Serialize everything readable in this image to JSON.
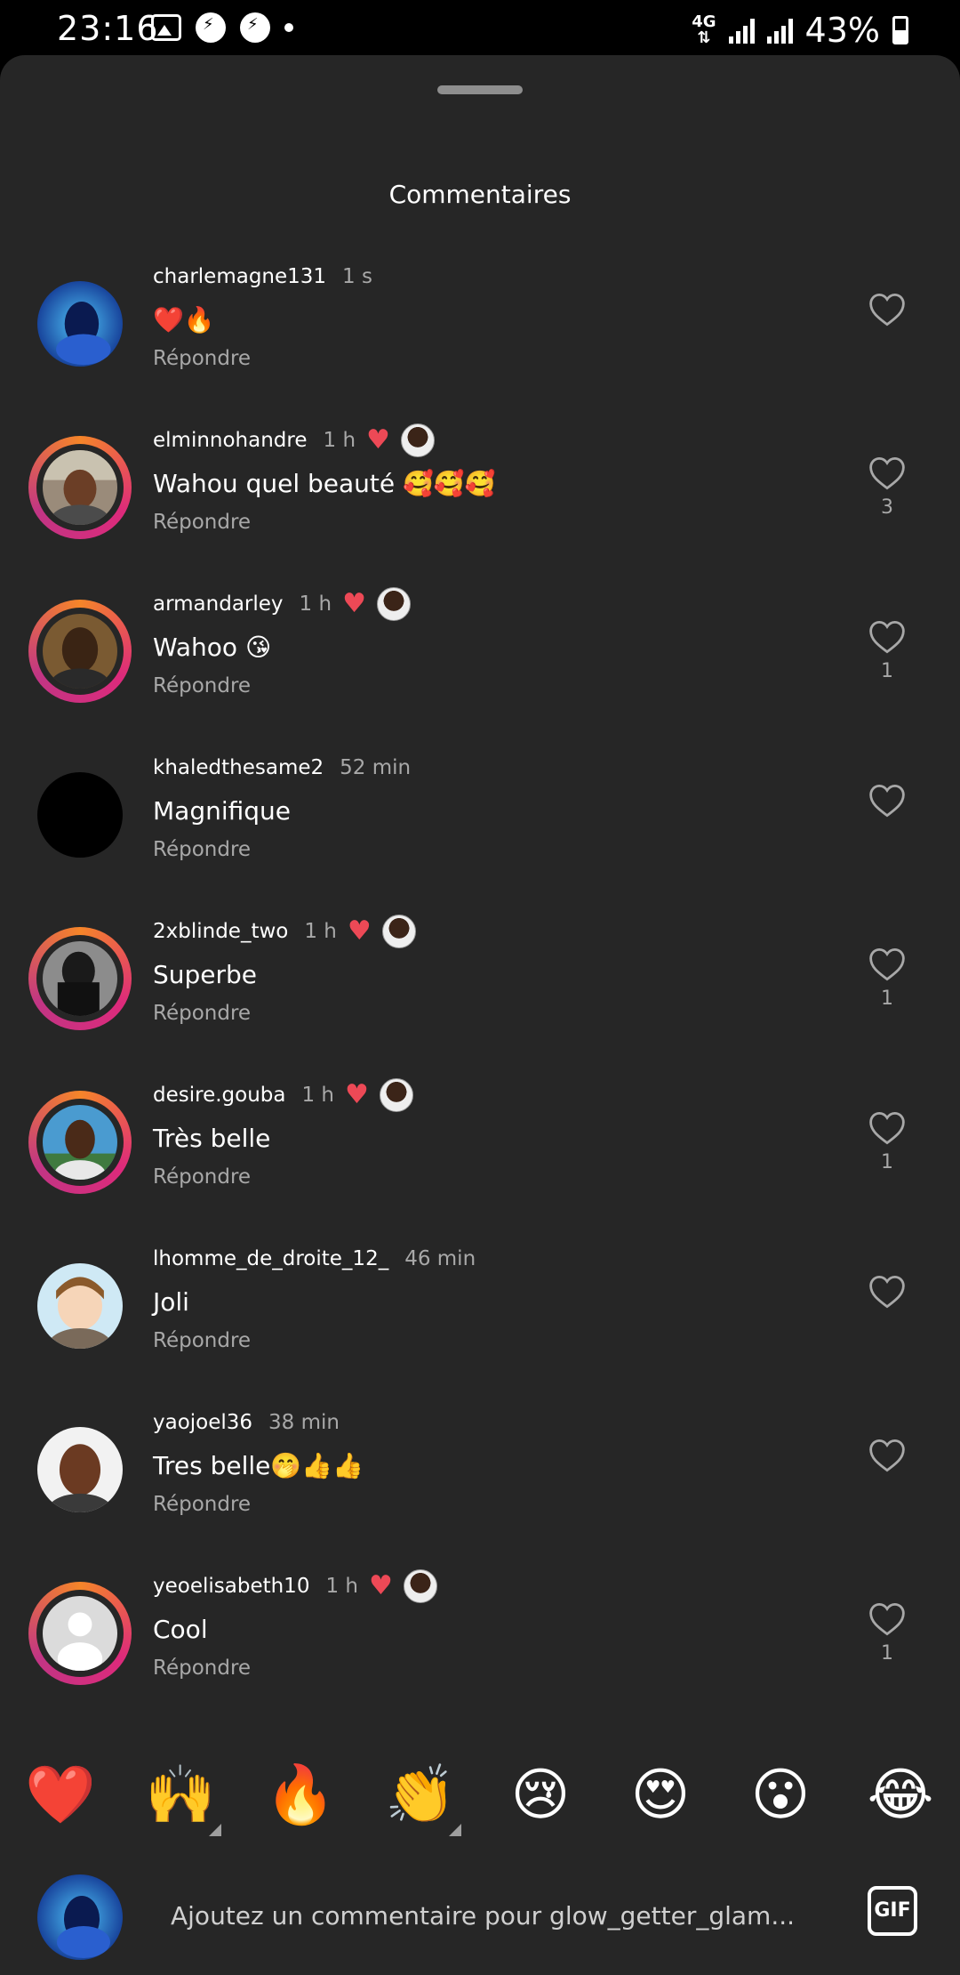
{
  "status_bar": {
    "time": "23:16",
    "network": "4G",
    "battery": "43%"
  },
  "sheet": {
    "title": "Commentaires"
  },
  "comments": [
    {
      "user": "charlemagne131",
      "time": "1 s",
      "text": "❤️🔥",
      "reply": "Répondre",
      "likes": "",
      "author_liked": false,
      "ring": false,
      "avatar": "blue"
    },
    {
      "user": "elminnohandre",
      "time": "1 h",
      "text": "Wahou quel beauté 🥰🥰🥰",
      "reply": "Répondre",
      "likes": "3",
      "author_liked": true,
      "ring": true,
      "avatar": "face1"
    },
    {
      "user": "armandarley",
      "time": "1 h",
      "text": "Wahoo 😘",
      "reply": "Répondre",
      "likes": "1",
      "author_liked": true,
      "ring": true,
      "avatar": "face2"
    },
    {
      "user": "khaledthesame2",
      "time": "52 min",
      "text": "Magnifique",
      "reply": "Répondre",
      "likes": "",
      "author_liked": false,
      "ring": false,
      "avatar": "black"
    },
    {
      "user": "2xblinde_two",
      "time": "1 h",
      "text": "Superbe",
      "reply": "Répondre",
      "likes": "1",
      "author_liked": true,
      "ring": true,
      "avatar": "hood"
    },
    {
      "user": "desire.gouba",
      "time": "1 h",
      "text": "Très belle",
      "reply": "Répondre",
      "likes": "1",
      "author_liked": true,
      "ring": true,
      "avatar": "face3"
    },
    {
      "user": "lhomme_de_droite_12_",
      "time": "46 min",
      "text": "Joli",
      "reply": "Répondre",
      "likes": "",
      "author_liked": false,
      "ring": false,
      "avatar": "anime"
    },
    {
      "user": "yaojoel36",
      "time": "38 min",
      "text": "Tres belle🤭👍👍",
      "reply": "Répondre",
      "likes": "",
      "author_liked": false,
      "ring": false,
      "avatar": "face4"
    },
    {
      "user": "yeoelisabeth10",
      "time": "1 h",
      "text": "Cool",
      "reply": "Répondre",
      "likes": "1",
      "author_liked": true,
      "ring": true,
      "avatar": "default"
    }
  ],
  "emoji_bar": [
    "❤️",
    "🙌",
    "🔥",
    "👏",
    "😢",
    "😍",
    "😮",
    "😂"
  ],
  "composer": {
    "placeholder": "Ajoutez un commentaire pour glow_getter_glam...",
    "gif_label": "GIF"
  },
  "colors": {
    "sheet_bg": "#262626",
    "heart_red": "#ed4956",
    "secondary_text": "#a8a8a8"
  }
}
